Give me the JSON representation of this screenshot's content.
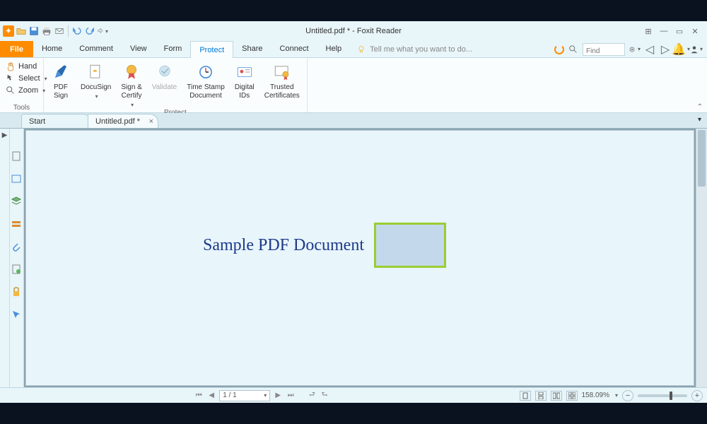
{
  "title": "Untitled.pdf * - Foxit Reader",
  "tabs": {
    "file": "File",
    "home": "Home",
    "comment": "Comment",
    "view": "View",
    "form": "Form",
    "protect": "Protect",
    "share": "Share",
    "connect": "Connect",
    "help": "Help"
  },
  "tellme": "Tell me what you want to do...",
  "search": {
    "placeholder": "Find"
  },
  "ribbon": {
    "tools_group": "Tools",
    "protect_group": "Protect",
    "hand": "Hand",
    "select": "Select",
    "zoom": "Zoom",
    "pdf_sign": "PDF\nSign",
    "docusign": "DocuSign",
    "sign_certify": "Sign &\nCertify",
    "validate": "Validate",
    "timestamp": "Time Stamp\nDocument",
    "digital_ids": "Digital\nIDs",
    "trusted_certs": "Trusted\nCertificates"
  },
  "doc_tabs": {
    "start": "Start",
    "doc": "Untitled.pdf *"
  },
  "document": {
    "heading": "Sample PDF Document"
  },
  "status": {
    "page": "1 / 1",
    "zoom": "158.09%"
  }
}
